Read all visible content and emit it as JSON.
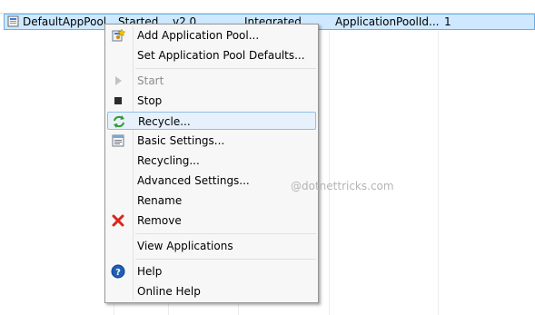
{
  "row": {
    "name": "DefaultAppPool",
    "status": "Started",
    "version": "v2.0",
    "pipeline": "Integrated",
    "identity": "ApplicationPoolId...",
    "applications": "1"
  },
  "menu": {
    "items": [
      {
        "label": "Add Application Pool...",
        "icon": "add-app-pool-icon"
      },
      {
        "label": "Set Application Pool Defaults..."
      },
      {
        "label": "Start",
        "icon": "play-icon",
        "disabled": true
      },
      {
        "label": "Stop",
        "icon": "stop-icon"
      },
      {
        "label": "Recycle...",
        "icon": "recycle-icon",
        "highlighted": true
      },
      {
        "label": "Basic Settings...",
        "icon": "basic-settings-icon"
      },
      {
        "label": "Recycling..."
      },
      {
        "label": "Advanced Settings..."
      },
      {
        "label": "Rename"
      },
      {
        "label": "Remove",
        "icon": "remove-icon"
      },
      {
        "label": "View Applications"
      },
      {
        "label": "Help",
        "icon": "help-icon"
      },
      {
        "label": "Online Help"
      }
    ]
  },
  "watermark": "@dotnettricks.com",
  "colors": {
    "selection_bg": "#cde8ff",
    "selection_border": "#6aaee6",
    "menu_bg": "#f7f7f7",
    "hover_bg": "#e7f1fb",
    "hover_border": "#8fbdec",
    "remove_red": "#d9261c",
    "help_blue": "#1e5fb5"
  }
}
